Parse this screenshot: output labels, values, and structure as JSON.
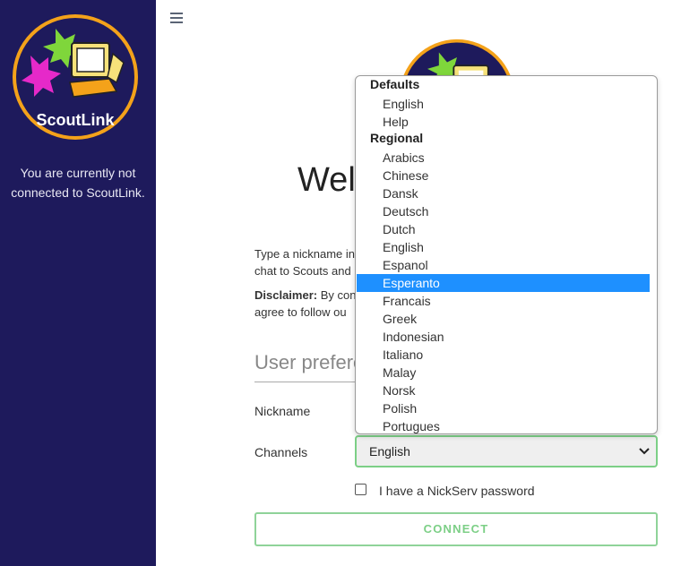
{
  "sidebar": {
    "logo_text": "ScoutLink",
    "status_line1": "You are currently not",
    "status_line2": "connected to ScoutLink."
  },
  "main": {
    "welcome_visible": "Welc",
    "intro_line1": "Type a nickname in",
    "intro_line2": "chat to Scouts and",
    "disclaimer_label": "Disclaimer:",
    "disclaimer_rest": " By con",
    "disclaimer_line2": "agree to follow ou",
    "prefs_heading": "User prefere",
    "nickname_label": "Nickname",
    "channels_label": "Channels",
    "channels_value": "English",
    "nickserv_label": "I have a NickServ password",
    "connect_label": "CONNECT"
  },
  "dropdown": {
    "groups": [
      {
        "label": "Defaults",
        "options": [
          "English",
          "Help"
        ]
      },
      {
        "label": "Regional",
        "options": [
          "Arabics",
          "Chinese",
          "Dansk",
          "Deutsch",
          "Dutch",
          "English",
          "Espanol",
          "Esperanto",
          "Francais",
          "Greek",
          "Indonesian",
          "Italiano",
          "Malay",
          "Norsk",
          "Polish",
          "Portugues"
        ]
      }
    ],
    "selected": "Esperanto",
    "highlight_color": "#1e90ff"
  },
  "colors": {
    "sidebar_bg": "#1e1a5c",
    "accent_green": "#7ccf86",
    "logo_orange": "#f4a21a"
  }
}
